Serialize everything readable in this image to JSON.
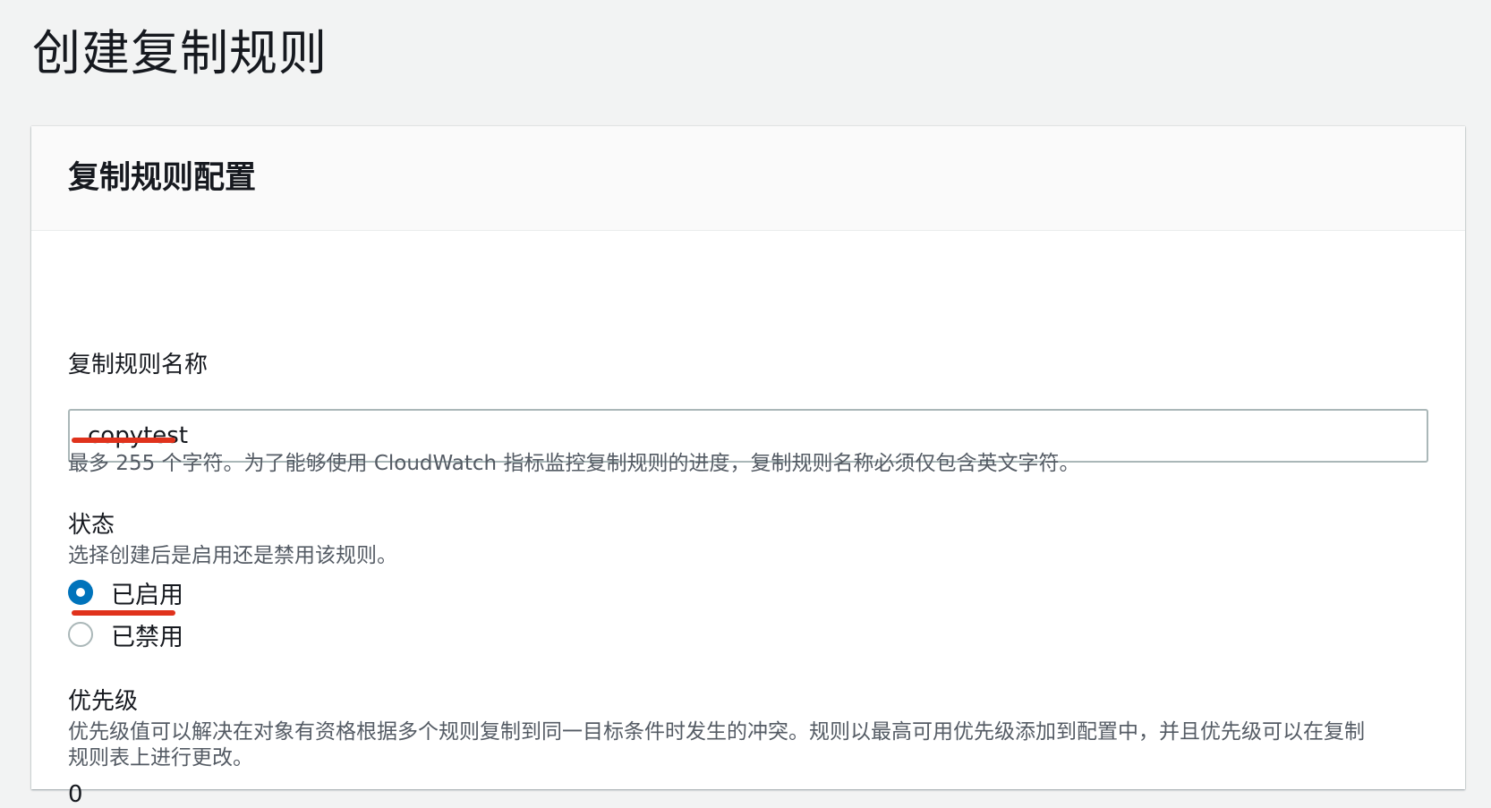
{
  "page": {
    "title": "创建复制规则"
  },
  "config_panel": {
    "title": "复制规则配置",
    "name_field": {
      "label": "复制规则名称",
      "value": "copytest",
      "hint": "最多 255 个字符。为了能够使用 CloudWatch 指标监控复制规则的进度，复制规则名称必须仅包含英文字符。"
    },
    "status": {
      "label": "状态",
      "description": "选择创建后是启用还是禁用该规则。",
      "options": [
        {
          "label": "已启用",
          "checked": true
        },
        {
          "label": "已禁用",
          "checked": false
        }
      ]
    },
    "priority": {
      "label": "优先级",
      "description_line1": "优先级值可以解决在对象有资格根据多个规则复制到同一目标条件时发生的冲突。规则以最高可用优先级添加到配置中，并且优先级可以在复制",
      "description_line2": "规则表上进行更改。",
      "value": "0"
    }
  },
  "colors": {
    "accent": "#0073bb",
    "annotation_underline": "#e0321c",
    "page_background": "#f2f3f3"
  }
}
